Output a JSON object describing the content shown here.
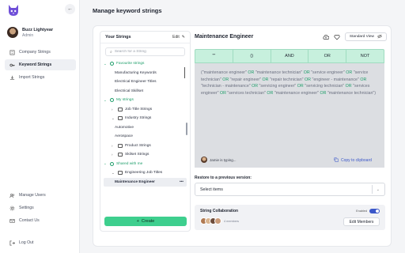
{
  "colors": {
    "accent": "#3ecf8e",
    "group_text": "#1e9e6a",
    "link": "#3b57c9",
    "operator_bar": "#c7f0dd"
  },
  "sidebar": {
    "collapse_icon": "arrow-left-icon",
    "profile": {
      "name": "Buzz Lightyear",
      "role": "Admin"
    },
    "nav": [
      {
        "label": "Company Strings",
        "icon": "building-icon",
        "active": false
      },
      {
        "label": "Keyword Strings",
        "icon": "key-icon",
        "active": true
      },
      {
        "label": "Import Strings",
        "icon": "import-icon",
        "active": false
      }
    ],
    "bottom_nav": [
      {
        "label": "Manage Users",
        "icon": "users-icon"
      },
      {
        "label": "Settings",
        "icon": "gear-icon"
      },
      {
        "label": "Contact Us",
        "icon": "mail-icon"
      }
    ],
    "logout": {
      "label": "Log Out",
      "icon": "logout-icon"
    }
  },
  "page": {
    "title": "Manage keyword strings"
  },
  "strings_panel": {
    "title": "Your Strings",
    "edit_label": "Edit",
    "search_placeholder": "Search for a String",
    "create_label": "Create",
    "tree": [
      {
        "label": "Favourite strings",
        "kind": "group",
        "level": 0
      },
      {
        "label": "Manufacturing Keywords",
        "kind": "item",
        "level": 2
      },
      {
        "label": "Electrical Engineer Titles",
        "kind": "item",
        "level": 2
      },
      {
        "label": "Electrical Skillset",
        "kind": "item",
        "level": 2
      },
      {
        "label": "My strings",
        "kind": "group",
        "level": 0
      },
      {
        "label": "Job Title Strings",
        "kind": "folder",
        "level": 1
      },
      {
        "label": "Industry Strings",
        "kind": "folder-open",
        "level": 1
      },
      {
        "label": "Automotive",
        "kind": "item",
        "level": 2
      },
      {
        "label": "Aerospace",
        "kind": "item",
        "level": 2
      },
      {
        "label": "Product Strings",
        "kind": "folder",
        "level": 1
      },
      {
        "label": "Skilset Strings",
        "kind": "folder",
        "level": 1
      },
      {
        "label": "Shared with me",
        "kind": "group",
        "level": 0
      },
      {
        "label": "Engineering Job Titles",
        "kind": "folder-open",
        "level": 1
      },
      {
        "label": "Maintenance Engineer",
        "kind": "selected",
        "level": 2,
        "more": "•••"
      }
    ]
  },
  "editor": {
    "title": "Maintenance Engineer",
    "view_label": "Standard View",
    "operators": [
      "\"\"",
      "()",
      "AND",
      "OR",
      "NOT"
    ],
    "string_parts": [
      {
        "t": "(\"maintenance engineer\" ",
        "k": false
      },
      {
        "t": "OR",
        "k": true
      },
      {
        "t": " \"maintenance technician\" ",
        "k": false
      },
      {
        "t": "OR",
        "k": true
      },
      {
        "t": " \"service engineer\" ",
        "k": false
      },
      {
        "t": "OR",
        "k": true
      },
      {
        "t": " \"service technician\" ",
        "k": false
      },
      {
        "t": "OR",
        "k": true
      },
      {
        "t": " \"repair engineer\" ",
        "k": false
      },
      {
        "t": "OR",
        "k": true
      },
      {
        "t": " \"repair technician\" ",
        "k": false
      },
      {
        "t": "OR",
        "k": true
      },
      {
        "t": " \"engineer - maintenance\" ",
        "k": false
      },
      {
        "t": "OR",
        "k": true
      },
      {
        "t": " \"technician - maintenance\" ",
        "k": false
      },
      {
        "t": "OR",
        "k": true
      },
      {
        "t": " \"servicing engineer\" ",
        "k": false
      },
      {
        "t": "OR",
        "k": true
      },
      {
        "t": " \"servicing technician\" ",
        "k": false
      },
      {
        "t": "OR",
        "k": true
      },
      {
        "t": " \"services engineer\" ",
        "k": false
      },
      {
        "t": "OR",
        "k": true
      },
      {
        "t": " \"services technician\" ",
        "k": false
      },
      {
        "t": "OR",
        "k": true
      },
      {
        "t": " \"maintenance engineer\" ",
        "k": false
      },
      {
        "t": "OR",
        "k": true
      },
      {
        "t": " \"maintenance technician\")",
        "k": false
      }
    ],
    "typing_text": "Jamie is typing...",
    "copy_label": "Copy to clipboard"
  },
  "restore": {
    "label": "Restore to a previous version:",
    "placeholder": "Select items"
  },
  "collab": {
    "title": "String Collaboration",
    "toggle_label": "Enabled",
    "members_count": "4 members",
    "edit_label": "Edit Members"
  }
}
